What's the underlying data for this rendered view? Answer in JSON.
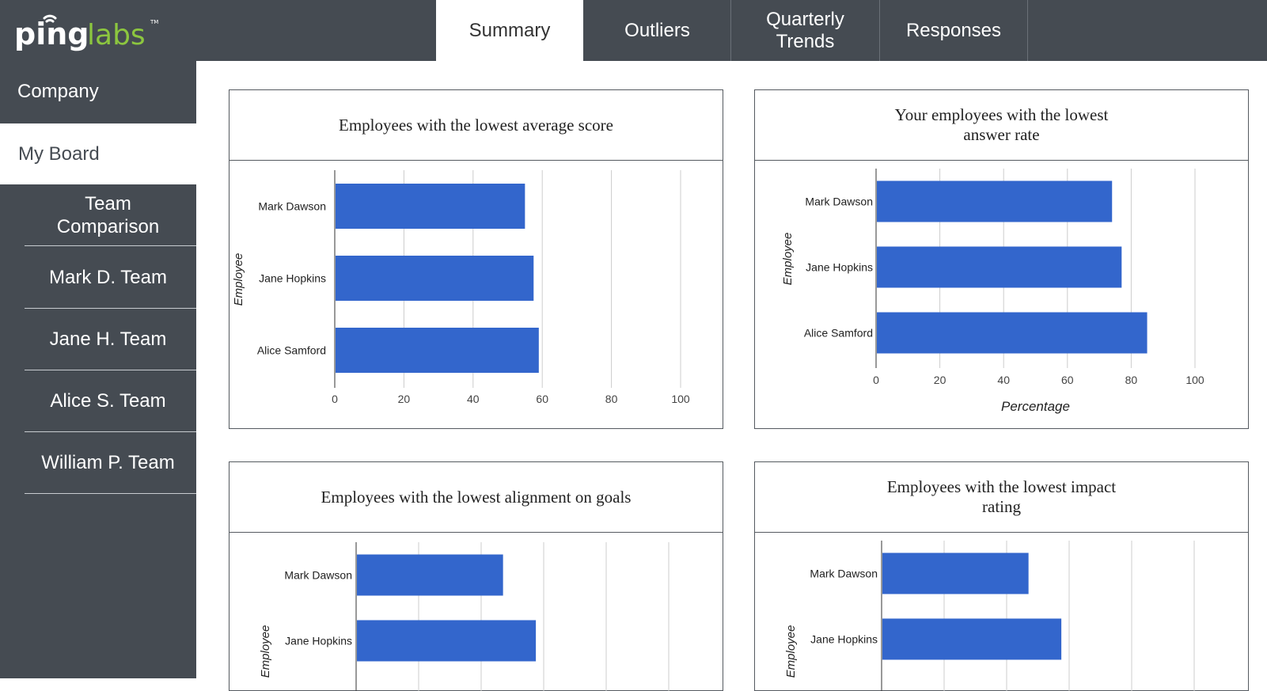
{
  "brand": {
    "logo_text_ping": "ping",
    "logo_text_labs": "labs",
    "logo_tm": "TM"
  },
  "tabs": [
    {
      "label": "Summary",
      "active": true
    },
    {
      "label": "Outliers",
      "active": false
    },
    {
      "label": "Quarterly Trends",
      "active": false
    },
    {
      "label": "Responses",
      "active": false
    }
  ],
  "sidebar": {
    "company": "Company",
    "my_board": "My Board",
    "teams": [
      "Team Comparison",
      "Mark D. Team",
      "Jane H. Team",
      "Alice S. Team",
      "William P. Team"
    ]
  },
  "colors": {
    "bar": "#3366cc",
    "chrome": "#454b52",
    "logo_green": "#8cc63f"
  },
  "chart_data": [
    {
      "type": "bar",
      "orientation": "horizontal",
      "title": "Employees with the lowest average score",
      "categories": [
        "Mark Dawson",
        "Jane Hopkins",
        "Alice Samford"
      ],
      "values": [
        55,
        57.5,
        59
      ],
      "ylabel": "Employee",
      "xlabel": "",
      "xlim": [
        0,
        100
      ],
      "ticks": [
        0,
        20,
        40,
        60,
        80,
        100
      ],
      "grid": true
    },
    {
      "type": "bar",
      "orientation": "horizontal",
      "title": "Your employees with the lowest answer rate",
      "categories": [
        "Mark Dawson",
        "Jane Hopkins",
        "Alice Samford"
      ],
      "values": [
        74,
        77,
        85
      ],
      "ylabel": "Employee",
      "xlabel": "Percentage",
      "xlim": [
        0,
        100
      ],
      "ticks": [
        0,
        20,
        40,
        60,
        80,
        100
      ],
      "grid": true
    },
    {
      "type": "bar",
      "orientation": "horizontal",
      "title": "Employees with the lowest alignment on goals",
      "categories": [
        "Mark Dawson",
        "Jane Hopkins"
      ],
      "values": [
        47,
        57.5
      ],
      "ylabel": "Employee",
      "xlabel": "",
      "xlim": [
        0,
        100
      ],
      "grid": true
    },
    {
      "type": "bar",
      "orientation": "horizontal",
      "title": "Employees with the lowest impact rating",
      "categories": [
        "Mark Dawson",
        "Jane Hopkins"
      ],
      "values": [
        47,
        57.5
      ],
      "ylabel": "Employee",
      "xlabel": "",
      "xlim": [
        0,
        100
      ],
      "grid": true
    }
  ]
}
